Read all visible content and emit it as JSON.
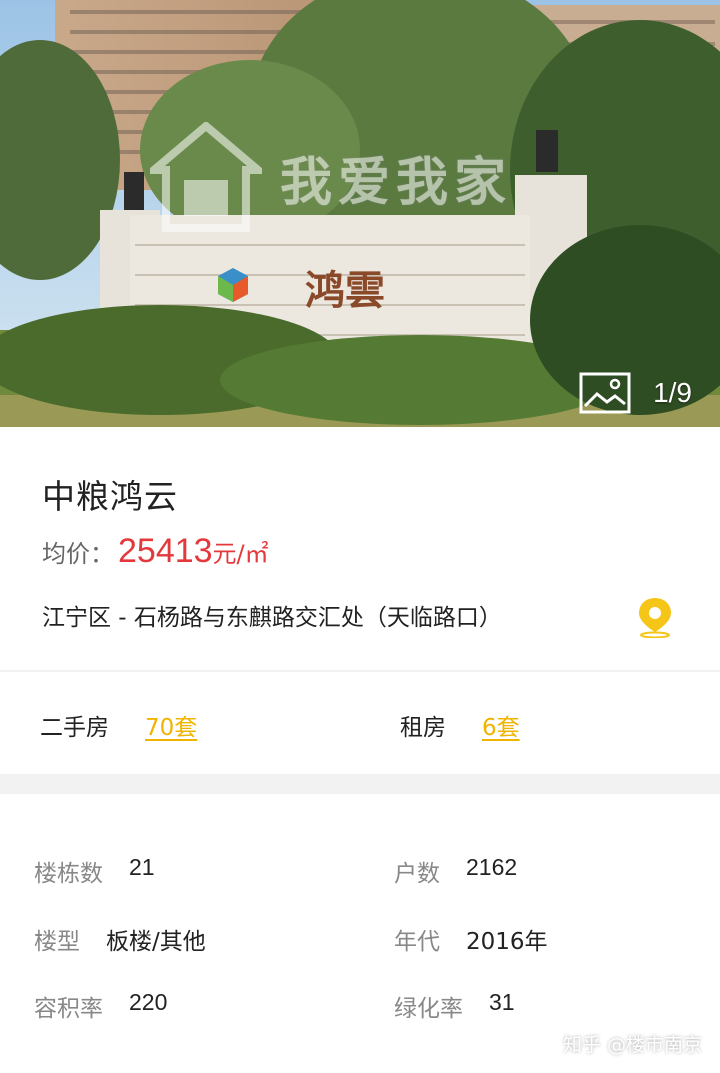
{
  "gallery": {
    "counter": "1/9",
    "overlay_logo": "我爱我家",
    "wall_sign": "鸿雲"
  },
  "project": {
    "name": "中粮鸿云",
    "price_label": "均价：",
    "price_value": "25413",
    "price_unit": "元/㎡",
    "address": "江宁区 - 石杨路与东麒路交汇处（天临路口）"
  },
  "listings": {
    "second_hand_label": "二手房",
    "second_hand_count": "70套",
    "rent_label": "租房",
    "rent_count": "6套"
  },
  "details": {
    "buildings_label": "楼栋数",
    "buildings_value": "21",
    "households_label": "户数",
    "households_value": "2162",
    "building_type_label": "楼型",
    "building_type_value": "板楼/其他",
    "year_label": "年代",
    "year_value": "2016年",
    "plot_ratio_label": "容积率",
    "plot_ratio_value": "220",
    "greening_label": "绿化率",
    "greening_value": "31"
  },
  "watermark": "知乎 @楼市南京",
  "colors": {
    "accent_price": "#e4393c",
    "accent_link": "#f0b400",
    "pin": "#f5c518"
  }
}
